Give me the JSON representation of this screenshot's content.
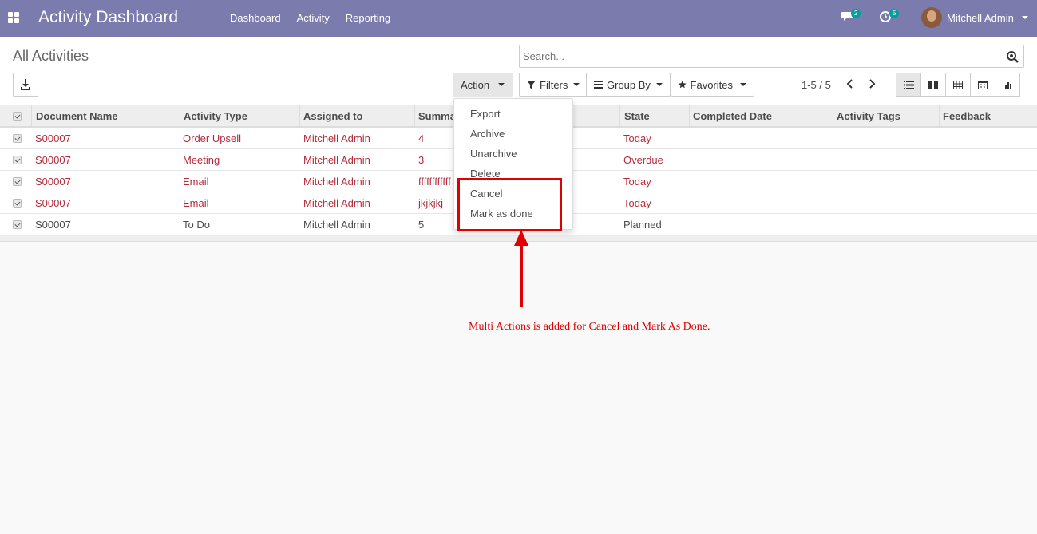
{
  "navbar": {
    "app_title": "Activity Dashboard",
    "menu": [
      "Dashboard",
      "Activity",
      "Reporting"
    ],
    "messages_count": "2",
    "activities_count": "5",
    "user_name": "Mitchell Admin"
  },
  "control_panel": {
    "title": "All Activities",
    "search_placeholder": "Search...",
    "action_label": "Action",
    "filters_label": "Filters",
    "groupby_label": "Group By",
    "favorites_label": "Favorites",
    "pager": "1-5 / 5"
  },
  "table": {
    "headers": [
      "Document Name",
      "Activity Type",
      "Assigned to",
      "Summary",
      "State",
      "Completed Date",
      "Activity Tags",
      "Feedback"
    ],
    "rows": [
      {
        "document": "S00007",
        "type": "Order Upsell",
        "assigned": "Mitchell Admin",
        "summary": "4",
        "state": "Today"
      },
      {
        "document": "S00007",
        "type": "Meeting",
        "assigned": "Mitchell Admin",
        "summary": "3",
        "state": "Overdue"
      },
      {
        "document": "S00007",
        "type": "Email",
        "assigned": "Mitchell Admin",
        "summary": "ffffffffffff",
        "state": "Today"
      },
      {
        "document": "S00007",
        "type": "Email",
        "assigned": "Mitchell Admin",
        "summary": "jkjkjkj",
        "state": "Today"
      },
      {
        "document": "S00007",
        "type": "To Do",
        "assigned": "Mitchell Admin",
        "summary": "5",
        "state": "Planned"
      }
    ]
  },
  "action_menu": [
    "Export",
    "Archive",
    "Unarchive",
    "Delete",
    "Cancel",
    "Mark as done"
  ],
  "annotation": "Multi Actions is added for Cancel and Mark As Done.",
  "colors": {
    "navbar": "#7c7bad",
    "highlight": "#e00000",
    "link_red": "#b52a3a"
  }
}
